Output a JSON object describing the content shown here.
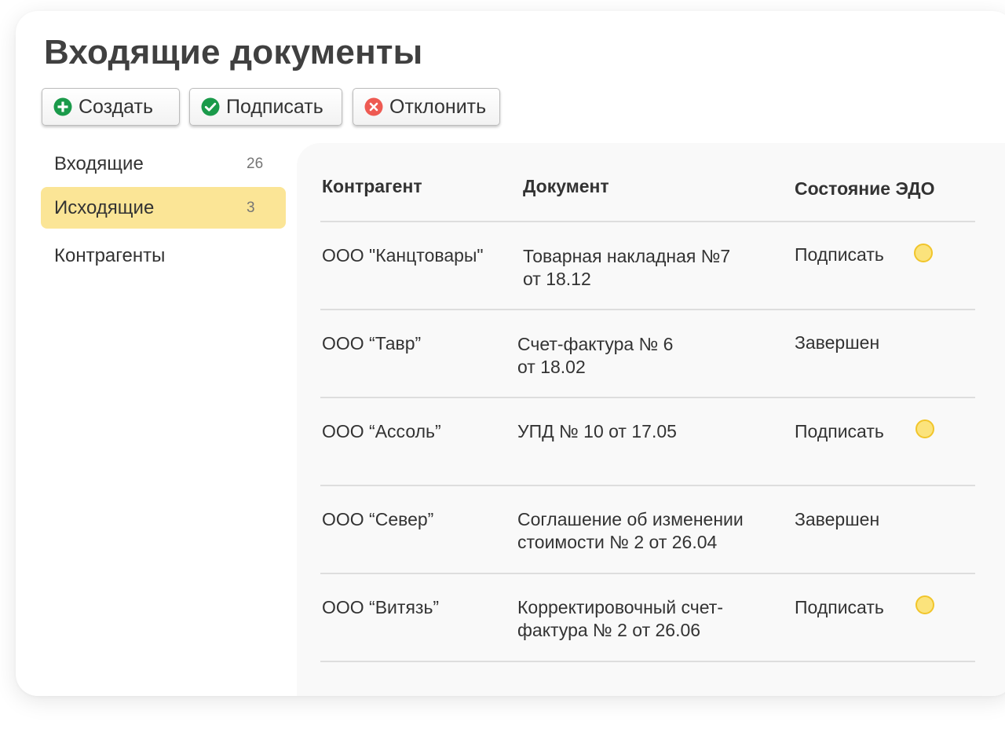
{
  "page": {
    "title": "Входящие документы"
  },
  "toolbar": {
    "create_label": "Создать",
    "sign_label": "Подписать",
    "reject_label": "Отклонить",
    "create_icon": "plus-circle-icon",
    "sign_icon": "check-circle-icon",
    "reject_icon": "x-circle-icon"
  },
  "sidebar": {
    "items": [
      {
        "label": "Входящие",
        "count": "26",
        "active": false
      },
      {
        "label": "Исходящие",
        "count": "3",
        "active": true
      },
      {
        "label": "Контрагенты",
        "count": "",
        "active": false
      }
    ]
  },
  "table": {
    "headers": [
      "Контрагент",
      "Документ",
      "Состояние ЭДО"
    ],
    "rows": [
      {
        "counterparty": "ООО \"Канцтовары\"",
        "doc_line1": "Товарная накладная №7",
        "doc_line2": "от 18.12",
        "status": "Подписать",
        "pending": true
      },
      {
        "counterparty": "ООО “Тавр”",
        "doc_line1": "Счет-фактура № 6",
        "doc_line2": "от 18.02",
        "status": "Завершен",
        "pending": false
      },
      {
        "counterparty": "ООО “Ассоль”",
        "doc_line1": "УПД № 10 от 17.05",
        "doc_line2": "",
        "status": "Подписать",
        "pending": true
      },
      {
        "counterparty": "ООО “Север”",
        "doc_line1": "Соглашение об изменении",
        "doc_line2": "стоимости № 2 от 26.04",
        "status": "Завершен",
        "pending": false
      },
      {
        "counterparty": "ООО “Витязь”",
        "doc_line1": "Корректировочный счет-",
        "doc_line2": "фактура № 2 от 26.06",
        "status": "Подписать",
        "pending": true
      }
    ]
  },
  "colors": {
    "active_item_bg": "#fbe596",
    "pending_dot": "#fbe37c",
    "create_icon": "#1a9a4a",
    "sign_icon": "#1a9a4a",
    "reject_icon": "#ee5a52"
  }
}
